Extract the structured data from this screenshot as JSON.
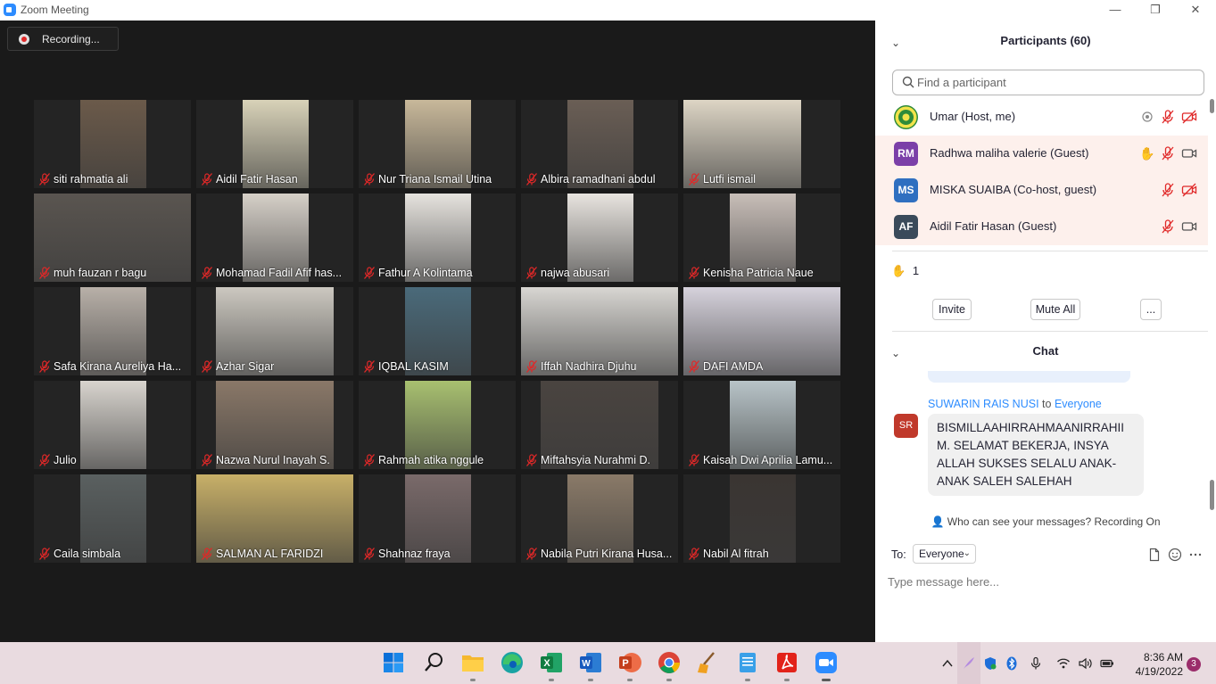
{
  "window": {
    "title": "Zoom Meeting",
    "minimize": "—",
    "maximize": "❐",
    "close": "✕"
  },
  "meeting": {
    "recording_label": "Recording...",
    "participants": [
      {
        "name": "siti rahmatia ali"
      },
      {
        "name": "Aidil Fatir Hasan"
      },
      {
        "name": "Nur Triana Ismail Utina"
      },
      {
        "name": "Albira ramadhani abdul"
      },
      {
        "name": "Lutfi ismail"
      },
      {
        "name": "muh fauzan r bagu"
      },
      {
        "name": "Mohamad Fadil Afif has..."
      },
      {
        "name": "Fathur A Kolintama"
      },
      {
        "name": "najwa abusari"
      },
      {
        "name": "Kenisha Patricia Naue"
      },
      {
        "name": "Safa  Kirana Aureliya Ha..."
      },
      {
        "name": "Azhar Sigar"
      },
      {
        "name": "IQBAL KASIM"
      },
      {
        "name": "Iffah Nadhira Djuhu"
      },
      {
        "name": "DAFI AMDA"
      },
      {
        "name": "Julio"
      },
      {
        "name": "Nazwa Nurul Inayah S."
      },
      {
        "name": "Rahmah atika nggule"
      },
      {
        "name": "Miftahsyia Nurahmi D."
      },
      {
        "name": "Kaisah Dwi Aprilia Lamu..."
      },
      {
        "name": "Caila simbala"
      },
      {
        "name": "SALMAN AL FARIDZI"
      },
      {
        "name": "Shahnaz fraya"
      },
      {
        "name": "Nabila Putri Kirana Husa..."
      },
      {
        "name": "Nabil Al fitrah"
      }
    ]
  },
  "participants_panel": {
    "title": "Participants (60)",
    "search_placeholder": "Find a participant",
    "rows": [
      {
        "initials": "",
        "name": "Umar (Host, me)",
        "color": "#2e8b3a"
      },
      {
        "initials": "RM",
        "name": "Radhwa maliha valerie (Guest)",
        "color": "#7b3fa8"
      },
      {
        "initials": "MS",
        "name": "MISKA SUAIBA (Co-host, guest)",
        "color": "#2f6fc0"
      },
      {
        "initials": "AF",
        "name": "Aidil Fatir Hasan (Guest)",
        "color": "#3a4a5a"
      }
    ],
    "raised_hands_count": "1",
    "invite_label": "Invite",
    "mute_all_label": "Mute All",
    "more_label": "..."
  },
  "chat_panel": {
    "title": "Chat",
    "message": {
      "sender": "SUWARIN RAIS NUSI",
      "to_word": " to ",
      "recipient": "Everyone",
      "initials": "SR",
      "text": "BISMILLAAHIRRAHMAANIRRAHII M. SELAMAT BEKERJA, INSYA ALLAH SUKSES SELALU ANAK-ANAK SALEH SALEHAH"
    },
    "visibility_note": "Who can see your messages? Recording On",
    "to_label": "To:",
    "to_value": "Everyone",
    "input_placeholder": "Type message here..."
  },
  "taskbar": {
    "apps": [
      "windows-start",
      "search",
      "file-explorer",
      "edge",
      "excel",
      "word",
      "powerpoint",
      "chrome",
      "ccleaner",
      "notepad",
      "adobe-reader",
      "zoom"
    ],
    "time": "8:36 AM",
    "date": "4/19/2022",
    "notifications": "3"
  },
  "colors": {
    "accent": "#2d8cff",
    "meeting_bg": "#1a1a1a",
    "tile_bg": "#242424",
    "taskbar": "#e9dbe0",
    "muted_red": "#e02828"
  }
}
